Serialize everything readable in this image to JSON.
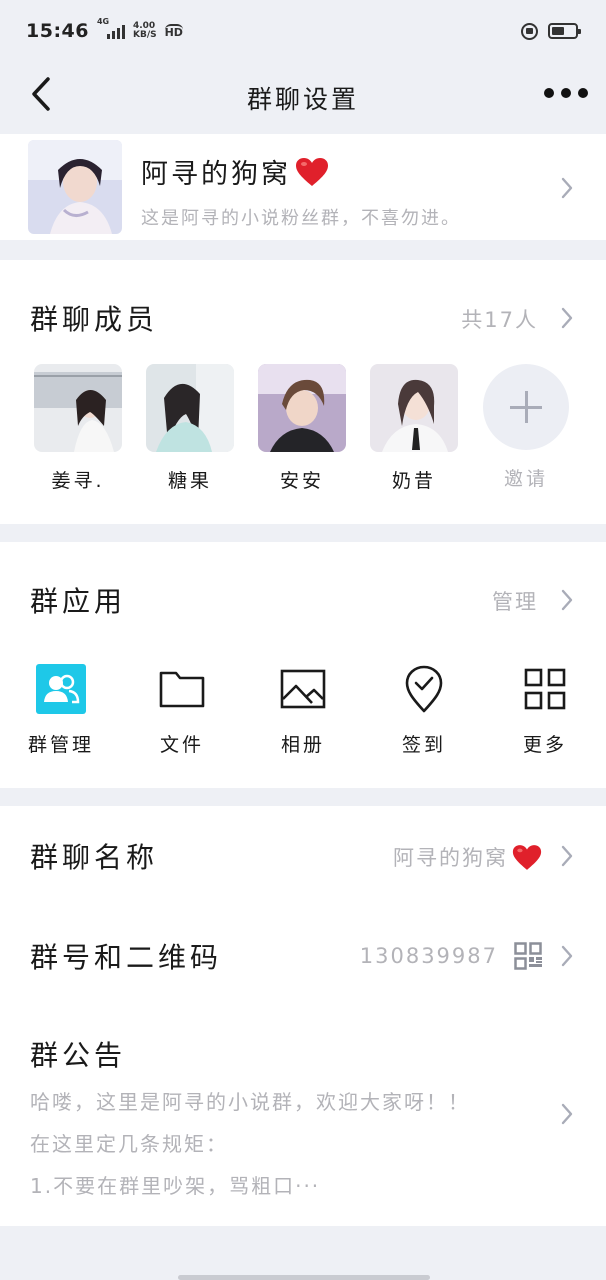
{
  "status_bar": {
    "time": "15:46",
    "network": "4G",
    "speed_value": "4.00",
    "speed_unit": "KB/S",
    "hd_label": "HD",
    "battery_level": 0.55
  },
  "nav": {
    "title": "群聊设置"
  },
  "group": {
    "name": "阿寻的狗窝",
    "name_emoji": "heart",
    "description": "这是阿寻的小说粉丝群，不喜勿进。"
  },
  "members": {
    "title": "群聊成员",
    "count_label": "共17人",
    "list": [
      {
        "name": "姜寻."
      },
      {
        "name": "糖果"
      },
      {
        "name": "安安"
      },
      {
        "name": "奶昔"
      }
    ],
    "invite_label": "邀请"
  },
  "apps": {
    "title": "群应用",
    "manage_label": "管理",
    "items": [
      {
        "label": "群管理",
        "icon": "group-manage-icon"
      },
      {
        "label": "文件",
        "icon": "folder-icon"
      },
      {
        "label": "相册",
        "icon": "photo-icon"
      },
      {
        "label": "签到",
        "icon": "checkin-icon"
      },
      {
        "label": "更多",
        "icon": "grid-icon"
      }
    ]
  },
  "info": {
    "group_name_title": "群聊名称",
    "group_name_value": "阿寻的狗窝",
    "group_number_title": "群号和二维码",
    "group_number_value": "130839987",
    "announcement_title": "群公告",
    "announcement_lines": [
      "哈喽，这里是阿寻的小说群，欢迎大家呀！！",
      "在这里定几条规矩：",
      "1.不要在群里吵架，骂粗口···"
    ]
  },
  "colors": {
    "background": "#eef0f5",
    "card": "#ffffff",
    "muted_text": "#b3b3b8",
    "heart": "#e0202b",
    "group_manage_bg": "#1ec8e8"
  }
}
